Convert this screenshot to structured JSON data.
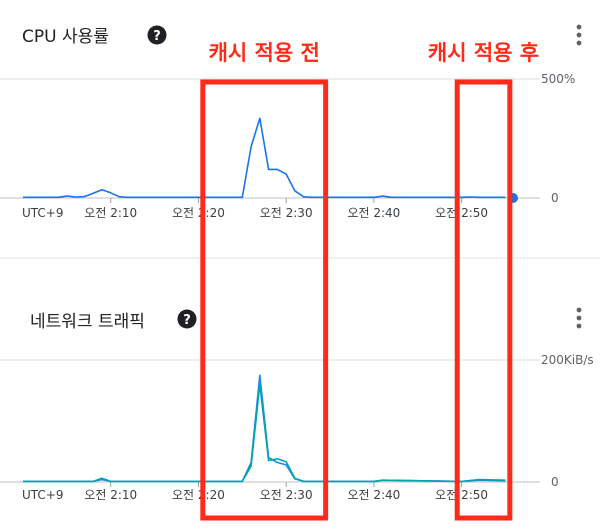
{
  "panels": [
    {
      "title": "CPU 사용률",
      "help_icon": "help-icon",
      "menu_icon": "more-vert-icon",
      "chart_data": {
        "type": "line",
        "ymax_label": "500%",
        "yzero_label": "0",
        "ylim": [
          0,
          500
        ],
        "x_tick_labels": [
          "UTC+9",
          "오전 2:10",
          "오전 2:20",
          "오전 2:30",
          "오전 2:40",
          "오전 2:50"
        ],
        "x_ticks": [
          0,
          10,
          20,
          30,
          40,
          50
        ],
        "xlim": [
          0,
          57
        ],
        "grid": "horizontal",
        "series": [
          {
            "color": "#1a73e8",
            "x": [
              0,
              4,
              5,
              6,
              7,
              8,
              9,
              10,
              11,
              12,
              22,
              25,
              26,
              27,
              28,
              29,
              30,
              31,
              32,
              33,
              40,
              41,
              42,
              50,
              51,
              52,
              55
            ],
            "y": [
              3,
              3,
              8,
              4,
              6,
              20,
              35,
              22,
              5,
              3,
              3,
              3,
              215,
              335,
              120,
              120,
              100,
              30,
              5,
              3,
              3,
              8,
              3,
              3,
              4,
              3,
              3
            ]
          }
        ],
        "end_marker": {
          "x": 57,
          "y": 0,
          "color": "#1a73e8"
        }
      }
    },
    {
      "title": "네트워크 트래픽",
      "help_icon": "help-icon",
      "menu_icon": "more-vert-icon",
      "chart_data": {
        "type": "line",
        "ymax_label": "200KiB/s",
        "yzero_label": "0",
        "ylim": [
          0,
          200
        ],
        "x_tick_labels": [
          "UTC+9",
          "오전 2:10",
          "오전 2:20",
          "오전 2:30",
          "오전 2:40",
          "오전 2:50"
        ],
        "x_ticks": [
          0,
          10,
          20,
          30,
          40,
          50
        ],
        "xlim": [
          0,
          57
        ],
        "grid": "horizontal",
        "series": [
          {
            "color": "#1e88e5",
            "x": [
              0,
              8,
              9,
              10,
              11,
              25,
              26,
              27,
              28,
              29,
              30,
              31,
              32,
              40,
              41,
              50,
              52,
              55
            ],
            "y": [
              1,
              1,
              4,
              1,
              1,
              1,
              32,
              175,
              40,
              32,
              28,
              5,
              1,
              1,
              3,
              1,
              3,
              2
            ]
          },
          {
            "color": "#00a7a7",
            "x": [
              0,
              8,
              9,
              10,
              11,
              25,
              26,
              27,
              28,
              29,
              30,
              31,
              32,
              40,
              41,
              50,
              52,
              55
            ],
            "y": [
              1,
              1,
              6,
              1,
              1,
              1,
              26,
              160,
              35,
              38,
              33,
              6,
              1,
              1,
              3,
              1,
              4,
              3
            ]
          }
        ]
      }
    }
  ],
  "annotations": [
    {
      "label": "캐시 적용 전",
      "color": "#ff2a1a",
      "x_from": 20.5,
      "x_to": 34.5
    },
    {
      "label": "캐시 적용 후",
      "color": "#ff2a1a",
      "x_from": 49.5,
      "x_to": 55.5
    }
  ]
}
